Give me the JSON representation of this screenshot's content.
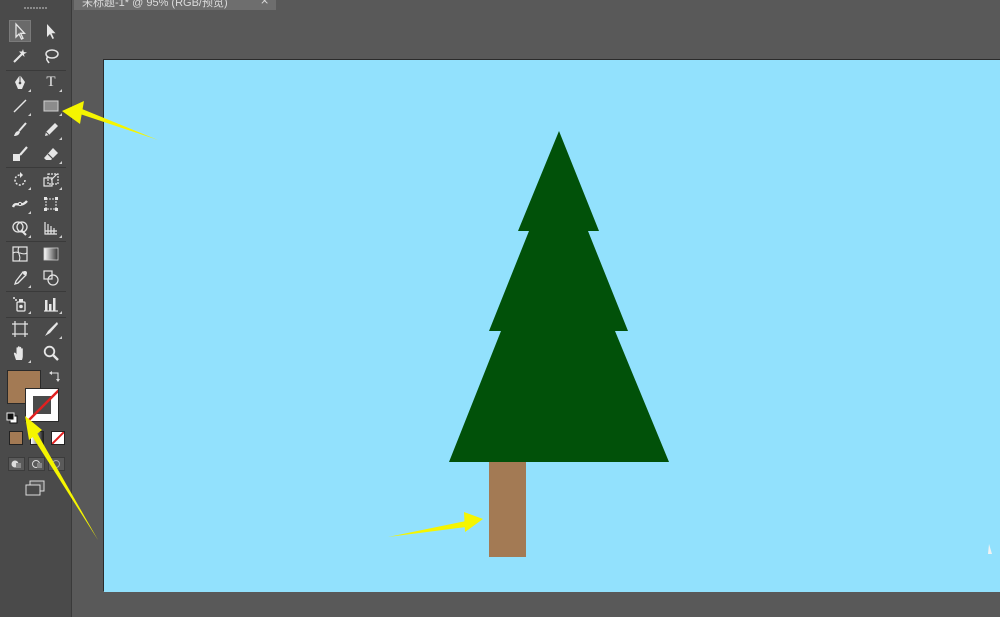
{
  "document": {
    "tab_title": "未标题-1* @ 95% (RGB/预览)",
    "close_glyph": "×"
  },
  "colors": {
    "panel_bg": "#4a4a4a",
    "canvas_bg": "#595959",
    "artboard_bg": "#92e1fd",
    "fill_color": "#a37a54",
    "stroke_color": "none",
    "tree_green": "#015109",
    "trunk_brown": "#a37a54",
    "arrow_yellow": "#f5f500"
  },
  "tools": [
    {
      "name": "selection-tool",
      "icon": "arrow-black-icon"
    },
    {
      "name": "direct-selection-tool",
      "icon": "arrow-white-icon"
    },
    {
      "name": "magic-wand-tool",
      "icon": "magic-wand-icon"
    },
    {
      "name": "lasso-tool",
      "icon": "lasso-icon"
    },
    {
      "name": "pen-tool",
      "icon": "pen-icon"
    },
    {
      "name": "type-tool",
      "icon": "type-icon"
    },
    {
      "name": "line-segment-tool",
      "icon": "line-icon"
    },
    {
      "name": "rectangle-tool",
      "icon": "rectangle-icon"
    },
    {
      "name": "paintbrush-tool",
      "icon": "brush-icon"
    },
    {
      "name": "pencil-tool",
      "icon": "pencil-icon"
    },
    {
      "name": "blob-brush-tool",
      "icon": "blob-brush-icon"
    },
    {
      "name": "eraser-tool",
      "icon": "eraser-icon"
    },
    {
      "name": "rotate-tool",
      "icon": "rotate-icon"
    },
    {
      "name": "scale-tool",
      "icon": "scale-icon"
    },
    {
      "name": "width-tool",
      "icon": "width-icon"
    },
    {
      "name": "free-transform-tool",
      "icon": "free-transform-icon"
    },
    {
      "name": "shape-builder-tool",
      "icon": "shape-builder-icon"
    },
    {
      "name": "perspective-grid-tool",
      "icon": "perspective-grid-icon"
    },
    {
      "name": "mesh-tool",
      "icon": "mesh-icon"
    },
    {
      "name": "gradient-tool",
      "icon": "gradient-icon"
    },
    {
      "name": "eyedropper-tool",
      "icon": "eyedropper-icon"
    },
    {
      "name": "blend-tool",
      "icon": "blend-icon"
    },
    {
      "name": "symbol-sprayer-tool",
      "icon": "symbol-sprayer-icon"
    },
    {
      "name": "column-graph-tool",
      "icon": "column-graph-icon"
    },
    {
      "name": "artboard-tool",
      "icon": "artboard-icon"
    },
    {
      "name": "slice-tool",
      "icon": "slice-icon"
    },
    {
      "name": "hand-tool",
      "icon": "hand-icon"
    },
    {
      "name": "zoom-tool",
      "icon": "zoom-icon"
    }
  ],
  "type_tool_glyph": "T"
}
